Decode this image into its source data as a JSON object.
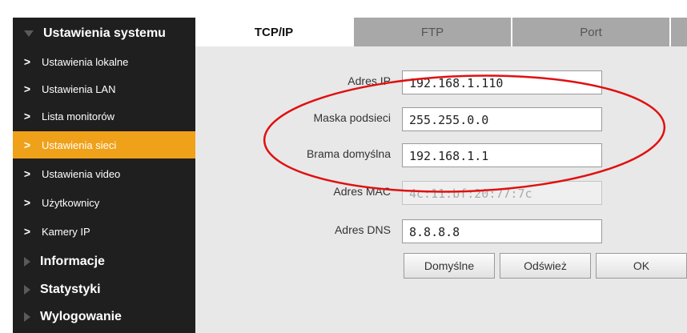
{
  "sidebar": {
    "sections": [
      {
        "label": "Ustawienia systemu",
        "expanded": true
      },
      {
        "label": "Informacje",
        "expanded": false
      },
      {
        "label": "Statystyki",
        "expanded": false
      },
      {
        "label": "Wylogowanie",
        "expanded": false
      }
    ],
    "items": [
      {
        "label": "Ustawienia lokalne",
        "icon": "chevron-right-icon"
      },
      {
        "label": "Ustawienia LAN",
        "icon": "chevron-right-icon"
      },
      {
        "label": "Lista monitorów",
        "icon": "chevron-right-icon"
      },
      {
        "label": "Ustawienia sieci",
        "icon": "chevron-right-icon",
        "active": true
      },
      {
        "label": "Ustawienia video",
        "icon": "chevron-right-icon"
      },
      {
        "label": "Użytkownicy",
        "icon": "chevron-right-icon"
      },
      {
        "label": "Kamery IP",
        "icon": "chevron-right-icon"
      }
    ],
    "chevron": ">"
  },
  "tabs": [
    {
      "label": "TCP/IP",
      "active": true
    },
    {
      "label": "FTP"
    },
    {
      "label": "Port"
    }
  ],
  "form": {
    "fields": [
      {
        "label": "Adres IP",
        "value": "192.168.1.110"
      },
      {
        "label": "Maska podsieci",
        "value": "255.255.0.0"
      },
      {
        "label": "Brama domyślna",
        "value": "192.168.1.1"
      },
      {
        "label": "Adres MAC",
        "value": "4c:11:bf:20:77:7c",
        "disabled": true
      },
      {
        "label": "Adres DNS",
        "value": "8.8.8.8"
      }
    ]
  },
  "buttons": {
    "default_label": "Domyślne",
    "refresh_label": "Odśwież",
    "ok_label": "OK"
  },
  "colors": {
    "sidebar_bg": "#1f1f1f",
    "active_item": "#f0a11a",
    "tab_inactive": "#a8a8a8",
    "content_bg": "#e8e8e8",
    "annotation": "#e01010"
  }
}
